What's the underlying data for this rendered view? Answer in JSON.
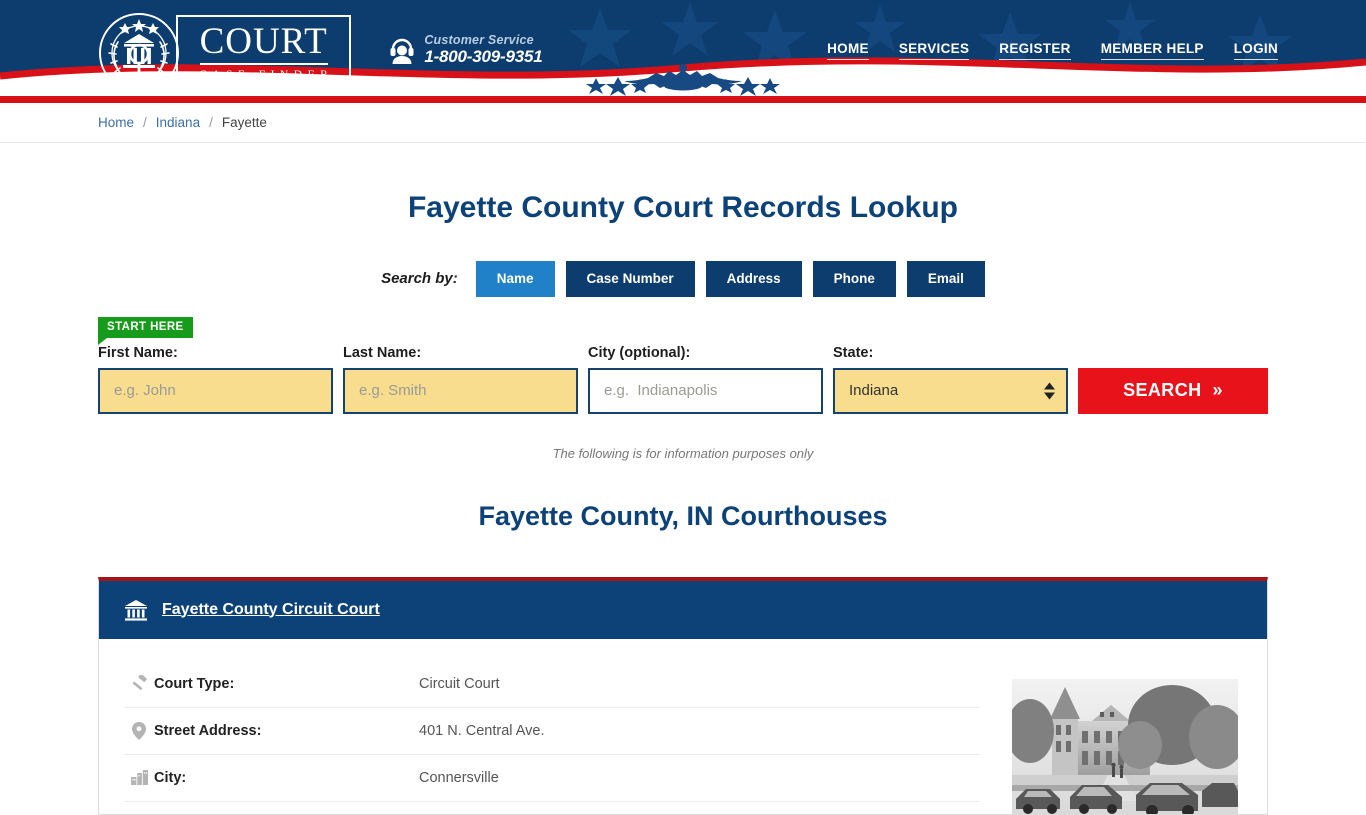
{
  "header": {
    "logo": {
      "title": "COURT",
      "subtitle": "CASE FINDER",
      "seal_icon": "court-seal-icon"
    },
    "customer_service": {
      "icon": "headset-support-icon",
      "label": "Customer Service",
      "phone": "1-800-309-9351"
    },
    "nav": [
      {
        "label": "HOME"
      },
      {
        "label": "SERVICES"
      },
      {
        "label": "REGISTER"
      },
      {
        "label": "MEMBER HELP"
      },
      {
        "label": "LOGIN"
      }
    ],
    "colors": {
      "navy": "#0d3c6e",
      "red": "#d81118",
      "accent_blue": "#2080c8"
    }
  },
  "breadcrumb": {
    "items": [
      {
        "label": "Home",
        "link": true
      },
      {
        "label": "Indiana",
        "link": true
      },
      {
        "label": "Fayette",
        "link": false
      }
    ],
    "separator": "/"
  },
  "main": {
    "page_title": "Fayette County Court Records Lookup",
    "search_by_label": "Search by:",
    "tabs": [
      {
        "label": "Name",
        "active": true
      },
      {
        "label": "Case Number",
        "active": false
      },
      {
        "label": "Address",
        "active": false
      },
      {
        "label": "Phone",
        "active": false
      },
      {
        "label": "Email",
        "active": false
      }
    ],
    "start_here_badge": "START HERE",
    "form": {
      "first_name": {
        "label": "First Name:",
        "placeholder": "e.g. John",
        "value": ""
      },
      "last_name": {
        "label": "Last Name:",
        "placeholder": "e.g. Smith",
        "value": ""
      },
      "city": {
        "label": "City (optional):",
        "placeholder": "e.g.  Indianapolis",
        "value": ""
      },
      "state": {
        "label": "State:",
        "selected": "Indiana"
      },
      "search_button": "SEARCH",
      "search_button_chevron": "»"
    },
    "disclaimer": "The following is for information purposes only",
    "section_title": "Fayette County, IN Courthouses"
  },
  "court_card": {
    "icon": "courthouse-icon",
    "name": "Fayette County Circuit Court",
    "photo_alt": "fayette-county-courthouse-photo",
    "details": [
      {
        "icon": "gavel-icon",
        "label": "Court Type:",
        "value": "Circuit Court"
      },
      {
        "icon": "map-pin-icon",
        "label": "Street Address:",
        "value": "401 N. Central Ave."
      },
      {
        "icon": "city-icon",
        "label": "City:",
        "value": "Connersville"
      }
    ]
  }
}
